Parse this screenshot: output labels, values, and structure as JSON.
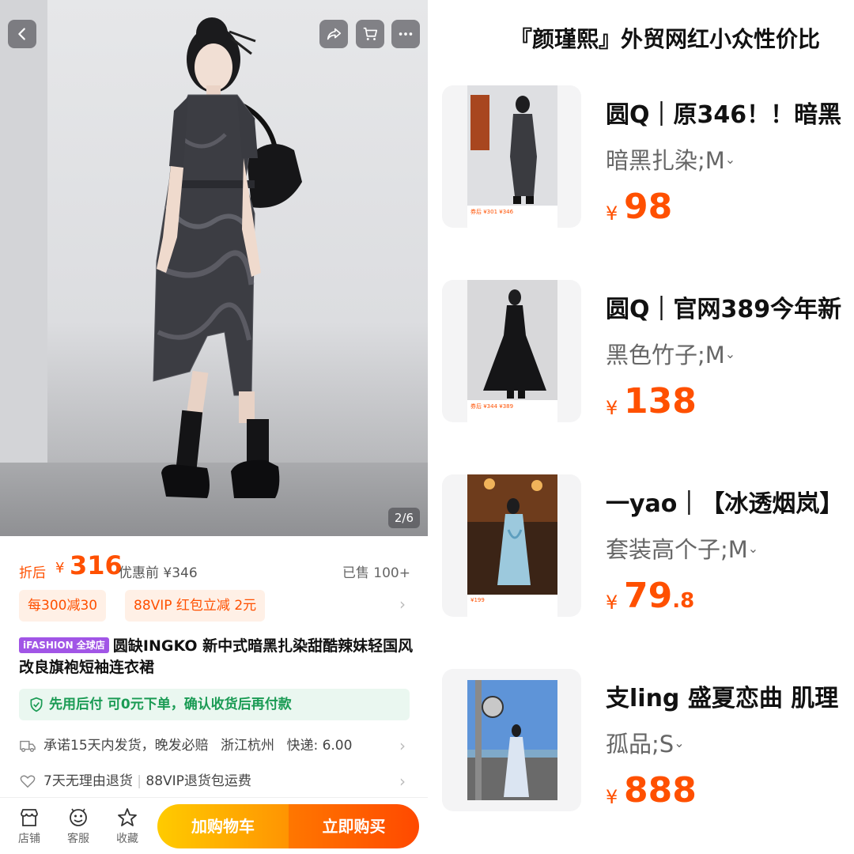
{
  "product": {
    "page_counter": "2/6",
    "after_label": "折后",
    "currency": "¥",
    "price": "316",
    "original_price": "优惠前 ¥346",
    "sold": "已售 100+",
    "coupons": [
      "每300减30",
      "88VIP 红包立减 2元"
    ],
    "badge": "iFASHION 全球店",
    "title": "圆缺INGKO 新中式暗黑扎染甜酷辣妹轻国风改良旗袍短袖连衣裙",
    "guarantee": "先用后付 可0元下单，确认收货后再付款",
    "shipping": "承诺15天内发货，晚发必赔",
    "location": "浙江杭州",
    "delivery_fee": "快递: 6.00",
    "returns": "7天无理由退货",
    "vip_returns": "88VIP退货包运费"
  },
  "bottom_nav": {
    "shop": "店铺",
    "service": "客服",
    "favorite": "收藏",
    "add_to_cart": "加购物车",
    "buy_now": "立即购买"
  },
  "cart_panel": {
    "shop_title": "『颜瑾熙』外贸网红小众性价比",
    "items": [
      {
        "name": "圆Q｜原346！！暗黑",
        "spec": "暗黑扎染;M",
        "price_int": "98",
        "price_dec": "",
        "thumb_strip": "券后 ¥301 ¥346"
      },
      {
        "name": "圆Q｜官网389今年新",
        "spec": "黑色竹子;M",
        "price_int": "138",
        "price_dec": "",
        "thumb_strip": "券后 ¥344 ¥389"
      },
      {
        "name": "一yao｜【冰透烟岚】",
        "spec": "套装高个子;M",
        "price_int": "79",
        "price_dec": ".8",
        "thumb_strip": "¥199"
      },
      {
        "name": "支ling 盛夏恋曲 肌理",
        "spec": "孤品;S",
        "price_int": "888",
        "price_dec": "",
        "thumb_strip": ""
      }
    ]
  },
  "colors": {
    "accent": "#ff5000",
    "coupon_bg": "#fff0e6",
    "guarantee_green": "#1a9b54",
    "badge_purple": "#a155e6"
  },
  "icons": [
    "back-icon",
    "share-icon",
    "cart-icon",
    "more-icon",
    "shield-icon",
    "truck-icon",
    "heart-icon",
    "store-icon",
    "service-icon",
    "star-icon"
  ]
}
